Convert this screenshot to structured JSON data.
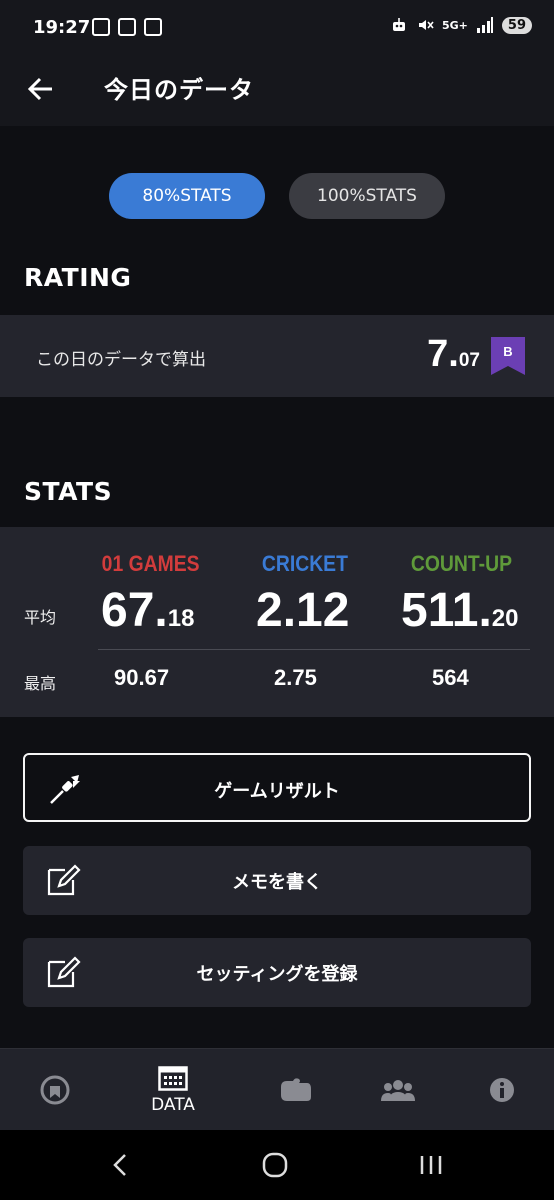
{
  "status": {
    "time": "19:27",
    "network": "5G+",
    "battery": "59"
  },
  "header": {
    "title": "今日のデータ"
  },
  "toggle": {
    "active": "80%STATS",
    "inactive": "100%STATS"
  },
  "rating": {
    "section_title": "RATING",
    "label": "この日のデータで算出",
    "value_int": "7.",
    "value_dec": "07",
    "badge": "B",
    "badge_color": "#6b3fb4"
  },
  "stats": {
    "section_title": "STATS",
    "columns": [
      {
        "name": "01 GAMES",
        "color": "#d23c3c",
        "avg_int": "67.",
        "avg_dec": "18",
        "best": "90.67"
      },
      {
        "name": "CRICKET",
        "color": "#3a7bd5",
        "avg_int": "2.12",
        "avg_dec": "",
        "best": "2.75"
      },
      {
        "name": "COUNT-UP",
        "color": "#5f9a3a",
        "avg_int": "511.",
        "avg_dec": "20",
        "best": "564"
      }
    ],
    "avg_label": "平均",
    "best_label": "最高"
  },
  "actions": [
    {
      "label": "ゲームリザルト",
      "icon": "dart-icon"
    },
    {
      "label": "メモを書く",
      "icon": "edit-icon"
    },
    {
      "label": "セッティングを登録",
      "icon": "edit-icon"
    }
  ],
  "nav": {
    "items": [
      {
        "icon": "badge-icon",
        "label": ""
      },
      {
        "icon": "calendar-icon",
        "label": "DATA"
      },
      {
        "icon": "puzzle-icon",
        "label": ""
      },
      {
        "icon": "group-icon",
        "label": ""
      },
      {
        "icon": "info-icon",
        "label": ""
      }
    ]
  }
}
